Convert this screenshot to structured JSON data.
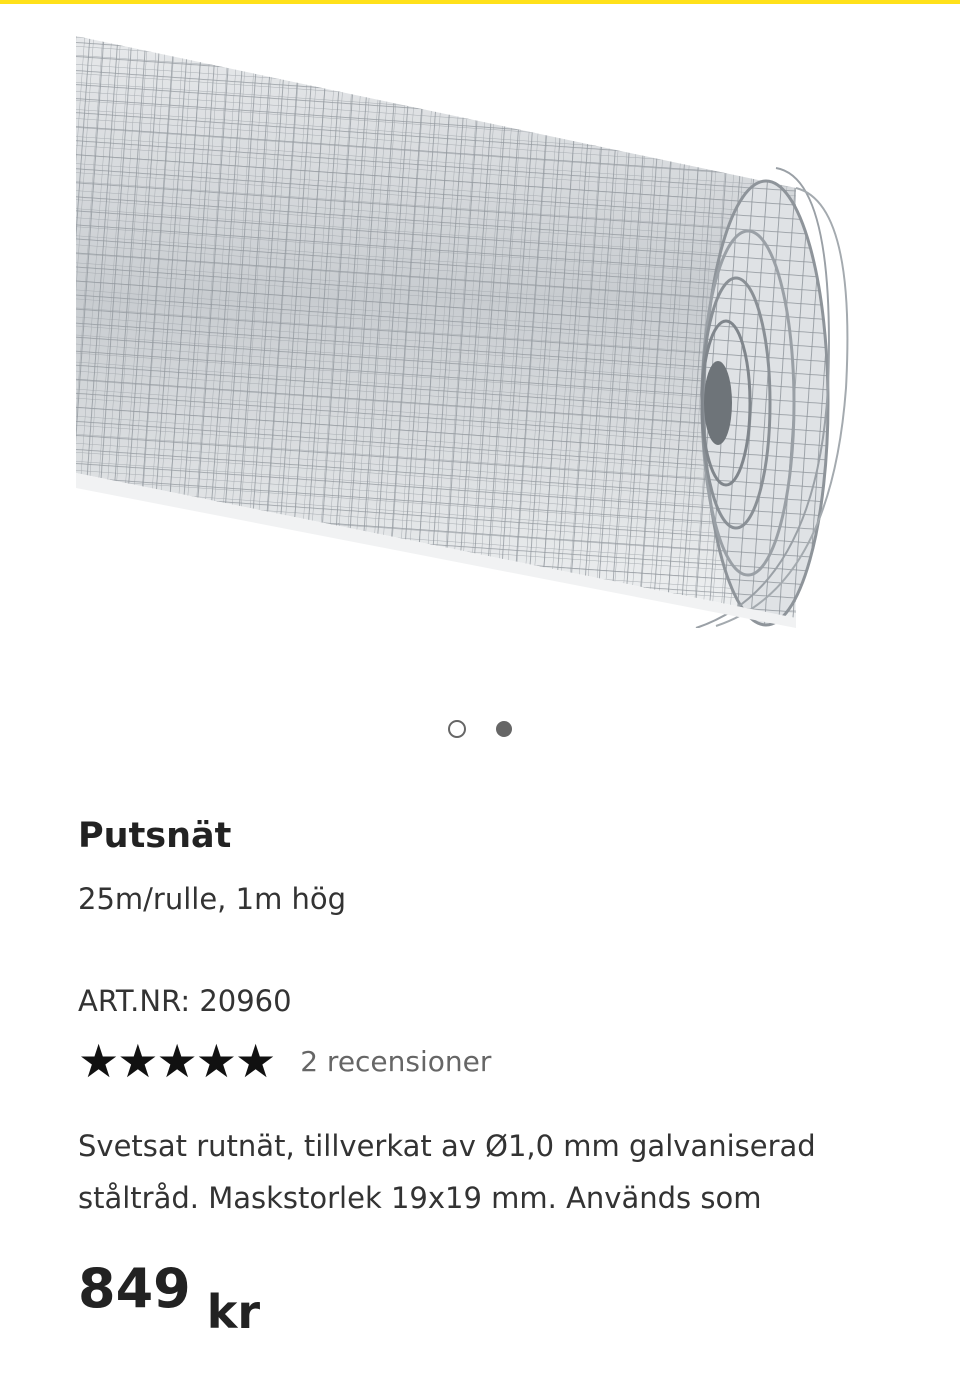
{
  "product": {
    "title": "Putsnät",
    "subtitle": "25m/rulle, 1m hög",
    "art_nr_label": "ART.NR:",
    "art_nr_value": "20960",
    "rating": {
      "stars": 5,
      "max_stars": 5,
      "star_glyph": "★★★★★",
      "review_count_label": "2 recensioner"
    },
    "description": "Svetsat rutnät, tillverkat av Ø1,0 mm galvaniserad ståltråd. Maskstorlek 19x19 mm. Används som",
    "price": {
      "amount": "849",
      "currency": "kr"
    }
  },
  "gallery": {
    "image_count": 2,
    "active_index": 1,
    "image_subject": "wire-mesh-roll-image"
  },
  "colors": {
    "accent_bar": "#ffe11a",
    "text_primary": "#222222",
    "text_muted": "#666666"
  }
}
